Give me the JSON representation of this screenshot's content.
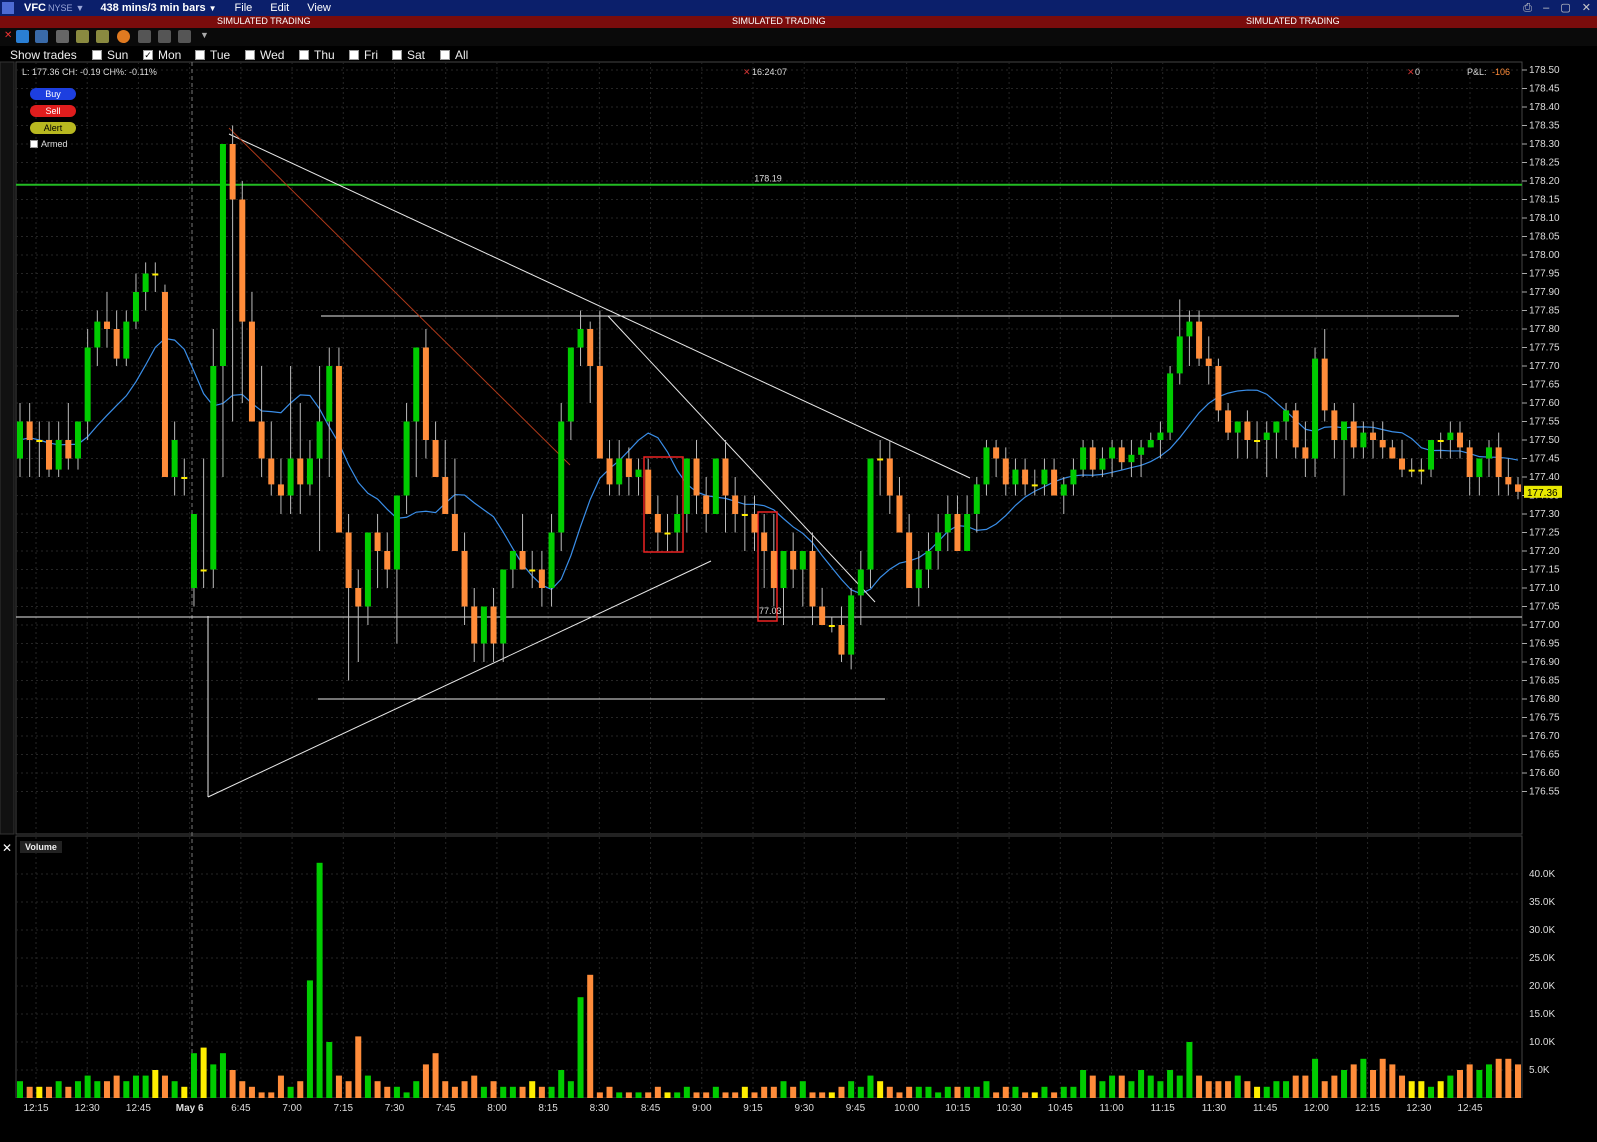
{
  "titlebar": {
    "symbol": "VFC",
    "exchange": "NYSE",
    "bars": "438 mins/3 min bars",
    "menu": [
      "File",
      "Edit",
      "View"
    ]
  },
  "sim_banner": [
    "SIMULATED TRADING",
    "SIMULATED TRADING",
    "SIMULATED TRADING"
  ],
  "show_trades": {
    "label": "Show trades",
    "days": [
      {
        "name": "Sun",
        "checked": false
      },
      {
        "name": "Mon",
        "checked": true
      },
      {
        "name": "Tue",
        "checked": false
      },
      {
        "name": "Wed",
        "checked": false
      },
      {
        "name": "Thu",
        "checked": false
      },
      {
        "name": "Fri",
        "checked": false
      },
      {
        "name": "Sat",
        "checked": false
      },
      {
        "name": "All",
        "checked": false
      }
    ]
  },
  "info": {
    "last": "L: 177.36 CH: -0.19  CH%: -0.11%",
    "time": "16:24:07",
    "position": "0",
    "pnl_label": "P&L:",
    "pnl_value": "-106"
  },
  "order_buttons": {
    "buy": "Buy",
    "sell": "Sell",
    "alert": "Alert",
    "armed": "Armed"
  },
  "volume_label": "Volume",
  "colors": {
    "up": "#00cc00",
    "down": "#ff8c3a",
    "neutral": "#ffee00",
    "ma": "#3a8ee8",
    "level": "#22bb22",
    "box": "#ee2222",
    "banner": "#7a0c0c"
  },
  "chart_data": {
    "type": "candlestick",
    "ylim": [
      176.5,
      178.5
    ],
    "price_ticks": [
      "178.50",
      "178.45",
      "178.40",
      "178.35",
      "178.30",
      "178.25",
      "178.20",
      "178.15",
      "178.10",
      "178.05",
      "178.00",
      "177.95",
      "177.90",
      "177.85",
      "177.80",
      "177.75",
      "177.70",
      "177.65",
      "177.60",
      "177.55",
      "177.50",
      "177.45",
      "177.40",
      "177.35",
      "177.30",
      "177.25",
      "177.20",
      "177.15",
      "177.10",
      "177.05",
      "177.00",
      "176.95",
      "176.90",
      "176.85",
      "176.80",
      "176.75",
      "176.70",
      "176.65",
      "176.60",
      "176.55"
    ],
    "time_labels": [
      "12:15",
      "12:30",
      "12:45",
      "May 6",
      "6:45",
      "7:00",
      "7:15",
      "7:30",
      "7:45",
      "8:00",
      "8:15",
      "8:30",
      "8:45",
      "9:00",
      "9:15",
      "9:30",
      "9:45",
      "10:00",
      "10:15",
      "10:30",
      "10:45",
      "11:00",
      "11:15",
      "11:30",
      "11:45",
      "12:00",
      "12:15",
      "12:30",
      "12:45"
    ],
    "last_price": "177.36",
    "horizontal_level": {
      "value": 178.19,
      "label": "178.19"
    },
    "annotation": "77.03",
    "volume_ticks": [
      "40.0K",
      "35.0K",
      "30.0K",
      "25.0K",
      "20.0K",
      "15.0K",
      "10.0K",
      "5.0K"
    ],
    "ohlc": [
      [
        177.45,
        177.6,
        177.4,
        177.55
      ],
      [
        177.55,
        177.6,
        177.4,
        177.5
      ],
      [
        177.5,
        177.55,
        177.4,
        177.5
      ],
      [
        177.5,
        177.55,
        177.4,
        177.42
      ],
      [
        177.42,
        177.55,
        177.4,
        177.5
      ],
      [
        177.5,
        177.6,
        177.42,
        177.45
      ],
      [
        177.45,
        177.55,
        177.42,
        177.55
      ],
      [
        177.55,
        177.8,
        177.5,
        177.75
      ],
      [
        177.75,
        177.85,
        177.7,
        177.82
      ],
      [
        177.82,
        177.9,
        177.75,
        177.8
      ],
      [
        177.8,
        177.85,
        177.7,
        177.72
      ],
      [
        177.72,
        177.85,
        177.7,
        177.82
      ],
      [
        177.82,
        177.95,
        177.8,
        177.9
      ],
      [
        177.9,
        177.98,
        177.85,
        177.95
      ],
      [
        177.95,
        177.98,
        177.9,
        177.95
      ],
      [
        177.9,
        177.92,
        177.7,
        177.4
      ],
      [
        177.4,
        177.55,
        177.35,
        177.5
      ],
      [
        177.4,
        177.45,
        177.35,
        177.4
      ],
      [
        177.1,
        177.3,
        177.05,
        177.3
      ],
      [
        177.15,
        177.45,
        177.1,
        177.15
      ],
      [
        177.15,
        177.8,
        177.1,
        177.7
      ],
      [
        177.7,
        177.95,
        177.4,
        178.3
      ],
      [
        178.3,
        178.35,
        177.55,
        178.15
      ],
      [
        178.15,
        178.2,
        177.6,
        177.82
      ],
      [
        177.82,
        177.9,
        177.55,
        177.55
      ],
      [
        177.55,
        177.7,
        177.4,
        177.45
      ],
      [
        177.45,
        177.55,
        177.35,
        177.38
      ],
      [
        177.38,
        177.45,
        177.3,
        177.35
      ],
      [
        177.35,
        177.7,
        177.3,
        177.45
      ],
      [
        177.45,
        177.6,
        177.3,
        177.38
      ],
      [
        177.38,
        177.5,
        177.35,
        177.45
      ],
      [
        177.45,
        177.7,
        177.2,
        177.55
      ],
      [
        177.55,
        177.75,
        177.4,
        177.7
      ],
      [
        177.7,
        177.75,
        177.3,
        177.25
      ],
      [
        177.25,
        177.3,
        176.85,
        177.1
      ],
      [
        177.1,
        177.15,
        176.9,
        177.05
      ],
      [
        177.05,
        177.25,
        177.0,
        177.25
      ],
      [
        177.25,
        177.3,
        177.1,
        177.2
      ],
      [
        177.2,
        177.25,
        177.1,
        177.15
      ],
      [
        177.15,
        177.3,
        176.95,
        177.35
      ],
      [
        177.35,
        177.6,
        177.3,
        177.55
      ],
      [
        177.55,
        177.75,
        177.4,
        177.75
      ],
      [
        177.75,
        177.8,
        177.45,
        177.5
      ],
      [
        177.5,
        177.55,
        177.4,
        177.4
      ],
      [
        177.4,
        177.5,
        177.3,
        177.3
      ],
      [
        177.3,
        177.45,
        177.2,
        177.2
      ],
      [
        177.2,
        177.25,
        177.0,
        177.05
      ],
      [
        177.05,
        177.1,
        176.9,
        176.95
      ],
      [
        176.95,
        177.05,
        176.9,
        177.05
      ],
      [
        177.05,
        177.1,
        176.9,
        176.95
      ],
      [
        176.95,
        177.15,
        176.9,
        177.15
      ],
      [
        177.15,
        177.2,
        177.1,
        177.2
      ],
      [
        177.2,
        177.3,
        177.15,
        177.15
      ],
      [
        177.15,
        177.2,
        177.1,
        177.15
      ],
      [
        177.15,
        177.2,
        177.05,
        177.1
      ],
      [
        177.1,
        177.3,
        177.05,
        177.25
      ],
      [
        177.25,
        177.6,
        177.2,
        177.55
      ],
      [
        177.55,
        177.75,
        177.5,
        177.75
      ],
      [
        177.75,
        177.85,
        177.7,
        177.8
      ],
      [
        177.8,
        177.82,
        177.6,
        177.7
      ],
      [
        177.7,
        177.85,
        177.45,
        177.45
      ],
      [
        177.45,
        177.5,
        177.35,
        177.38
      ],
      [
        177.38,
        177.5,
        177.35,
        177.45
      ],
      [
        177.45,
        177.48,
        177.35,
        177.4
      ],
      [
        177.4,
        177.45,
        177.35,
        177.42
      ],
      [
        177.42,
        177.45,
        177.3,
        177.3
      ],
      [
        177.3,
        177.35,
        177.2,
        177.25
      ],
      [
        177.25,
        177.3,
        177.2,
        177.25
      ],
      [
        177.25,
        177.35,
        177.2,
        177.3
      ],
      [
        177.3,
        177.45,
        177.25,
        177.45
      ],
      [
        177.45,
        177.5,
        177.3,
        177.35
      ],
      [
        177.35,
        177.4,
        177.25,
        177.3
      ],
      [
        177.3,
        177.45,
        177.3,
        177.45
      ],
      [
        177.45,
        177.5,
        177.25,
        177.35
      ],
      [
        177.35,
        177.4,
        177.25,
        177.3
      ],
      [
        177.3,
        177.35,
        177.2,
        177.3
      ],
      [
        177.3,
        177.35,
        177.2,
        177.25
      ],
      [
        177.25,
        177.3,
        177.1,
        177.2
      ],
      [
        177.2,
        177.3,
        177.05,
        177.1
      ],
      [
        177.1,
        177.2,
        177.0,
        177.2
      ],
      [
        177.2,
        177.25,
        177.1,
        177.15
      ],
      [
        177.15,
        177.2,
        177.05,
        177.2
      ],
      [
        177.2,
        177.25,
        177.0,
        177.05
      ],
      [
        177.05,
        177.1,
        177.0,
        177.0
      ],
      [
        177.0,
        177.02,
        176.98,
        177.0
      ],
      [
        177.0,
        177.05,
        176.9,
        176.92
      ],
      [
        176.92,
        177.1,
        176.88,
        177.08
      ],
      [
        177.08,
        177.2,
        177.0,
        177.15
      ],
      [
        177.15,
        177.45,
        177.1,
        177.45
      ],
      [
        177.45,
        177.5,
        177.35,
        177.45
      ],
      [
        177.45,
        177.5,
        177.3,
        177.35
      ],
      [
        177.35,
        177.4,
        177.25,
        177.25
      ],
      [
        177.25,
        177.3,
        177.1,
        177.1
      ],
      [
        177.1,
        177.2,
        177.05,
        177.15
      ],
      [
        177.15,
        177.25,
        177.1,
        177.2
      ],
      [
        177.2,
        177.3,
        177.15,
        177.25
      ],
      [
        177.25,
        177.35,
        177.2,
        177.3
      ],
      [
        177.3,
        177.35,
        177.2,
        177.2
      ],
      [
        177.2,
        177.35,
        177.2,
        177.3
      ],
      [
        177.3,
        177.4,
        177.25,
        177.38
      ],
      [
        177.38,
        177.5,
        177.35,
        177.48
      ],
      [
        177.48,
        177.5,
        177.4,
        177.45
      ],
      [
        177.45,
        177.48,
        177.35,
        177.38
      ],
      [
        177.38,
        177.45,
        177.35,
        177.42
      ],
      [
        177.42,
        177.45,
        177.35,
        177.38
      ],
      [
        177.38,
        177.42,
        177.35,
        177.38
      ],
      [
        177.38,
        177.45,
        177.35,
        177.42
      ],
      [
        177.42,
        177.45,
        177.35,
        177.35
      ],
      [
        177.35,
        177.4,
        177.3,
        177.38
      ],
      [
        177.38,
        177.45,
        177.35,
        177.42
      ],
      [
        177.42,
        177.5,
        177.4,
        177.48
      ],
      [
        177.48,
        177.5,
        177.4,
        177.42
      ],
      [
        177.42,
        177.48,
        177.4,
        177.45
      ],
      [
        177.45,
        177.5,
        177.4,
        177.48
      ],
      [
        177.48,
        177.5,
        177.42,
        177.44
      ],
      [
        177.44,
        177.5,
        177.4,
        177.46
      ],
      [
        177.46,
        177.5,
        177.4,
        177.48
      ],
      [
        177.48,
        177.52,
        177.48,
        177.5
      ],
      [
        177.5,
        177.55,
        177.45,
        177.52
      ],
      [
        177.52,
        177.7,
        177.5,
        177.68
      ],
      [
        177.68,
        177.88,
        177.65,
        177.78
      ],
      [
        177.78,
        177.85,
        177.7,
        177.82
      ],
      [
        177.82,
        177.85,
        177.7,
        177.72
      ],
      [
        177.72,
        177.78,
        177.65,
        177.7
      ],
      [
        177.7,
        177.72,
        177.55,
        177.58
      ],
      [
        177.58,
        177.6,
        177.5,
        177.52
      ],
      [
        177.52,
        177.55,
        177.45,
        177.55
      ],
      [
        177.55,
        177.58,
        177.45,
        177.5
      ],
      [
        177.5,
        177.55,
        177.45,
        177.5
      ],
      [
        177.5,
        177.55,
        177.4,
        177.52
      ],
      [
        177.52,
        177.55,
        177.45,
        177.55
      ],
      [
        177.55,
        177.6,
        177.5,
        177.58
      ],
      [
        177.58,
        177.6,
        177.45,
        177.48
      ],
      [
        177.48,
        177.55,
        177.4,
        177.45
      ],
      [
        177.45,
        177.75,
        177.4,
        177.72
      ],
      [
        177.72,
        177.8,
        177.55,
        177.58
      ],
      [
        177.58,
        177.6,
        177.45,
        177.5
      ],
      [
        177.5,
        177.55,
        177.35,
        177.55
      ],
      [
        177.55,
        177.6,
        177.45,
        177.48
      ],
      [
        177.48,
        177.55,
        177.45,
        177.52
      ],
      [
        177.52,
        177.55,
        177.45,
        177.5
      ],
      [
        177.5,
        177.55,
        177.45,
        177.48
      ],
      [
        177.48,
        177.5,
        177.45,
        177.45
      ],
      [
        177.45,
        177.5,
        177.4,
        177.42
      ],
      [
        177.42,
        177.45,
        177.4,
        177.42
      ],
      [
        177.42,
        177.45,
        177.38,
        177.42
      ],
      [
        177.42,
        177.5,
        177.4,
        177.5
      ],
      [
        177.5,
        177.52,
        177.45,
        177.5
      ],
      [
        177.5,
        177.55,
        177.45,
        177.52
      ],
      [
        177.52,
        177.55,
        177.45,
        177.48
      ],
      [
        177.48,
        177.5,
        177.35,
        177.4
      ],
      [
        177.4,
        177.45,
        177.35,
        177.45
      ],
      [
        177.45,
        177.5,
        177.4,
        177.48
      ],
      [
        177.48,
        177.52,
        177.35,
        177.4
      ],
      [
        177.4,
        177.45,
        177.35,
        177.38
      ],
      [
        177.38,
        177.4,
        177.34,
        177.36
      ]
    ],
    "volume": [
      3,
      2,
      2,
      2,
      3,
      2,
      3,
      4,
      3,
      3,
      4,
      3,
      4,
      4,
      5,
      4,
      3,
      2,
      8,
      9,
      6,
      8,
      5,
      3,
      2,
      1,
      1,
      4,
      2,
      3,
      21,
      42,
      10,
      4,
      3,
      11,
      4,
      3,
      2,
      2,
      1,
      3,
      6,
      8,
      3,
      2,
      3,
      4,
      2,
      3,
      2,
      2,
      2,
      3,
      2,
      2,
      5,
      3,
      18,
      22,
      1,
      2,
      1,
      1,
      1,
      1,
      2,
      1,
      1,
      2,
      1,
      1,
      2,
      1,
      1,
      2,
      1,
      2,
      2,
      3,
      2,
      3,
      1,
      1,
      1,
      2,
      3,
      2,
      4,
      3,
      2,
      1,
      2,
      2,
      2,
      1,
      2,
      2,
      2,
      2,
      3,
      1,
      2,
      2,
      1,
      1,
      2,
      1,
      2,
      2,
      5,
      4,
      3,
      4,
      4,
      3,
      5,
      4,
      3,
      5,
      4,
      10,
      4,
      3,
      3,
      3,
      4,
      3,
      2,
      2,
      3,
      3,
      4,
      4,
      7,
      3,
      4,
      5,
      6,
      7,
      5,
      7,
      6,
      4,
      3,
      3,
      2,
      3,
      4,
      5,
      6,
      5,
      6,
      7,
      7,
      6,
      7,
      8,
      13,
      9
    ]
  }
}
